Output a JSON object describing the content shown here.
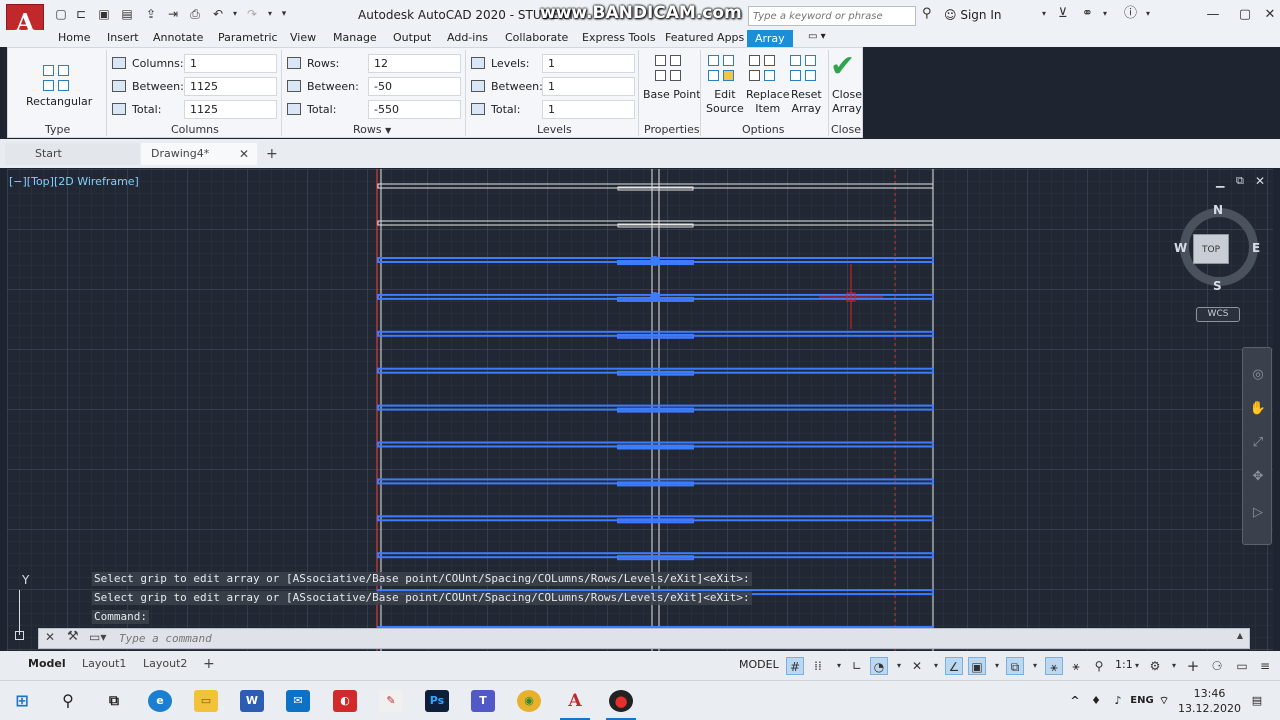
{
  "window": {
    "title": "Autodesk AutoCAD 2020 - STUDENT",
    "watermark": "www.BANDICAM.com",
    "search_placeholder": "Type a keyword or phrase",
    "sign_in": "Sign In"
  },
  "ribbon_tabs": [
    "Home",
    "Insert",
    "Annotate",
    "Parametric",
    "View",
    "Manage",
    "Output",
    "Add-ins",
    "Collaborate",
    "Express Tools",
    "Featured Apps",
    "Array"
  ],
  "ribbon": {
    "type": {
      "button_label": "Rectangular",
      "panel_title": "Type"
    },
    "columns": {
      "panel_title": "Columns",
      "fields": [
        {
          "label": "Columns:",
          "value": "1"
        },
        {
          "label": "Between:",
          "value": "1125"
        },
        {
          "label": "Total:",
          "value": "1125"
        }
      ]
    },
    "rows": {
      "panel_title": "Rows",
      "fields": [
        {
          "label": "Rows:",
          "value": "12"
        },
        {
          "label": "Between:",
          "value": "-50"
        },
        {
          "label": "Total:",
          "value": "-550"
        }
      ]
    },
    "levels": {
      "panel_title": "Levels",
      "fields": [
        {
          "label": "Levels:",
          "value": "1"
        },
        {
          "label": "Between:",
          "value": "1"
        },
        {
          "label": "Total:",
          "value": "1"
        }
      ]
    },
    "properties": {
      "button_label": "Base Point",
      "panel_title": "Properties"
    },
    "options": {
      "panel_title": "Options",
      "buttons": [
        {
          "line1": "Edit",
          "line2": "Source"
        },
        {
          "line1": "Replace",
          "line2": "Item"
        },
        {
          "line1": "Reset",
          "line2": "Array"
        }
      ]
    },
    "close": {
      "line1": "Close",
      "line2": "Array",
      "panel_title": "Close"
    }
  },
  "file_tabs": {
    "start": "Start",
    "drawing": "Drawing4*"
  },
  "viewport": {
    "label": "[−][Top][2D Wireframe]",
    "compass": {
      "n": "N",
      "s": "S",
      "e": "E",
      "w": "W"
    },
    "cube_face": "TOP",
    "wcs": "WCS"
  },
  "ucs": {
    "y_label": "Y"
  },
  "command": {
    "history": [
      "Select grip to edit array or [ASsociative/Base point/COUnt/Spacing/COLumns/Rows/Levels/eXit]<eXit>:",
      "Select grip to edit array or [ASsociative/Base point/COUnt/Spacing/COLumns/Rows/Levels/eXit]<eXit>:",
      "Command:"
    ],
    "placeholder": "Type a command"
  },
  "layout_tabs": [
    "Model",
    "Layout1",
    "Layout2"
  ],
  "status": {
    "model": "MODEL",
    "scale": "1:1"
  },
  "clock": {
    "time": "13:46",
    "date": "13.12.2020"
  },
  "colors": {
    "accent": "#1a8fd8",
    "selection": "#3d7bff",
    "canvas": "#212833"
  }
}
